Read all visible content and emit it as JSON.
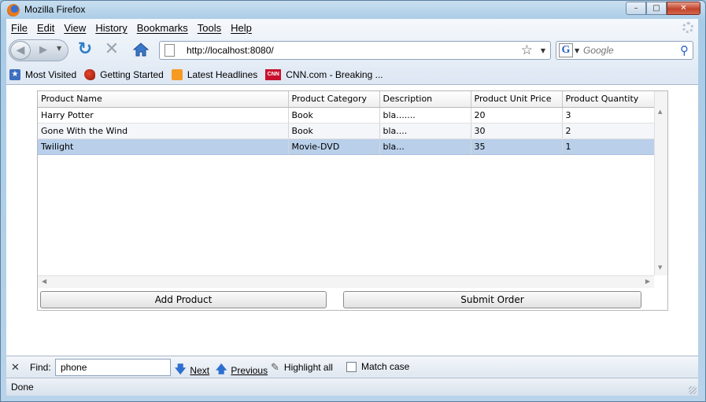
{
  "window": {
    "title": "Mozilla Firefox",
    "controls": {
      "minimize": "–",
      "maximize": "□",
      "close": "✕"
    }
  },
  "menubar": {
    "items": [
      "File",
      "Edit",
      "View",
      "History",
      "Bookmarks",
      "Tools",
      "Help"
    ]
  },
  "navbar": {
    "url": "http://localhost:8080/",
    "search_placeholder": "Google",
    "search_engine_letter": "G"
  },
  "bookmarks": {
    "items": [
      "Most Visited",
      "Getting Started",
      "Latest Headlines",
      "CNN.com - Breaking ..."
    ],
    "cnn_badge": "CNN"
  },
  "grid": {
    "columns": [
      "Product Name",
      "Product Category",
      "Description",
      "Product Unit Price",
      "Product Quantity"
    ],
    "rows": [
      [
        "Harry Potter",
        "Book",
        "bla.......",
        "20",
        "3"
      ],
      [
        "Gone With the Wind",
        "Book",
        "bla....",
        "30",
        "2"
      ],
      [
        "Twilight",
        "Movie-DVD",
        "bla...",
        "35",
        "1"
      ]
    ],
    "selected_row_index": 2
  },
  "buttons": {
    "add_product": "Add Product",
    "submit_order": "Submit Order"
  },
  "findbar": {
    "label": "Find:",
    "value": "phone",
    "next": "Next",
    "previous": "Previous",
    "highlight_all": "Highlight all",
    "match_case": "Match case"
  },
  "status": {
    "text": "Done"
  },
  "colors": {
    "selected_row": "#b9cfea",
    "accent": "#2d7dc8"
  },
  "icons": [
    "firefox-icon",
    "back-icon",
    "forward-icon",
    "reload-icon",
    "stop-icon",
    "home-icon",
    "page-icon",
    "star-icon",
    "search-icon",
    "rss-icon",
    "close-icon",
    "arrow-down-icon",
    "arrow-up-icon",
    "pencil-icon"
  ]
}
